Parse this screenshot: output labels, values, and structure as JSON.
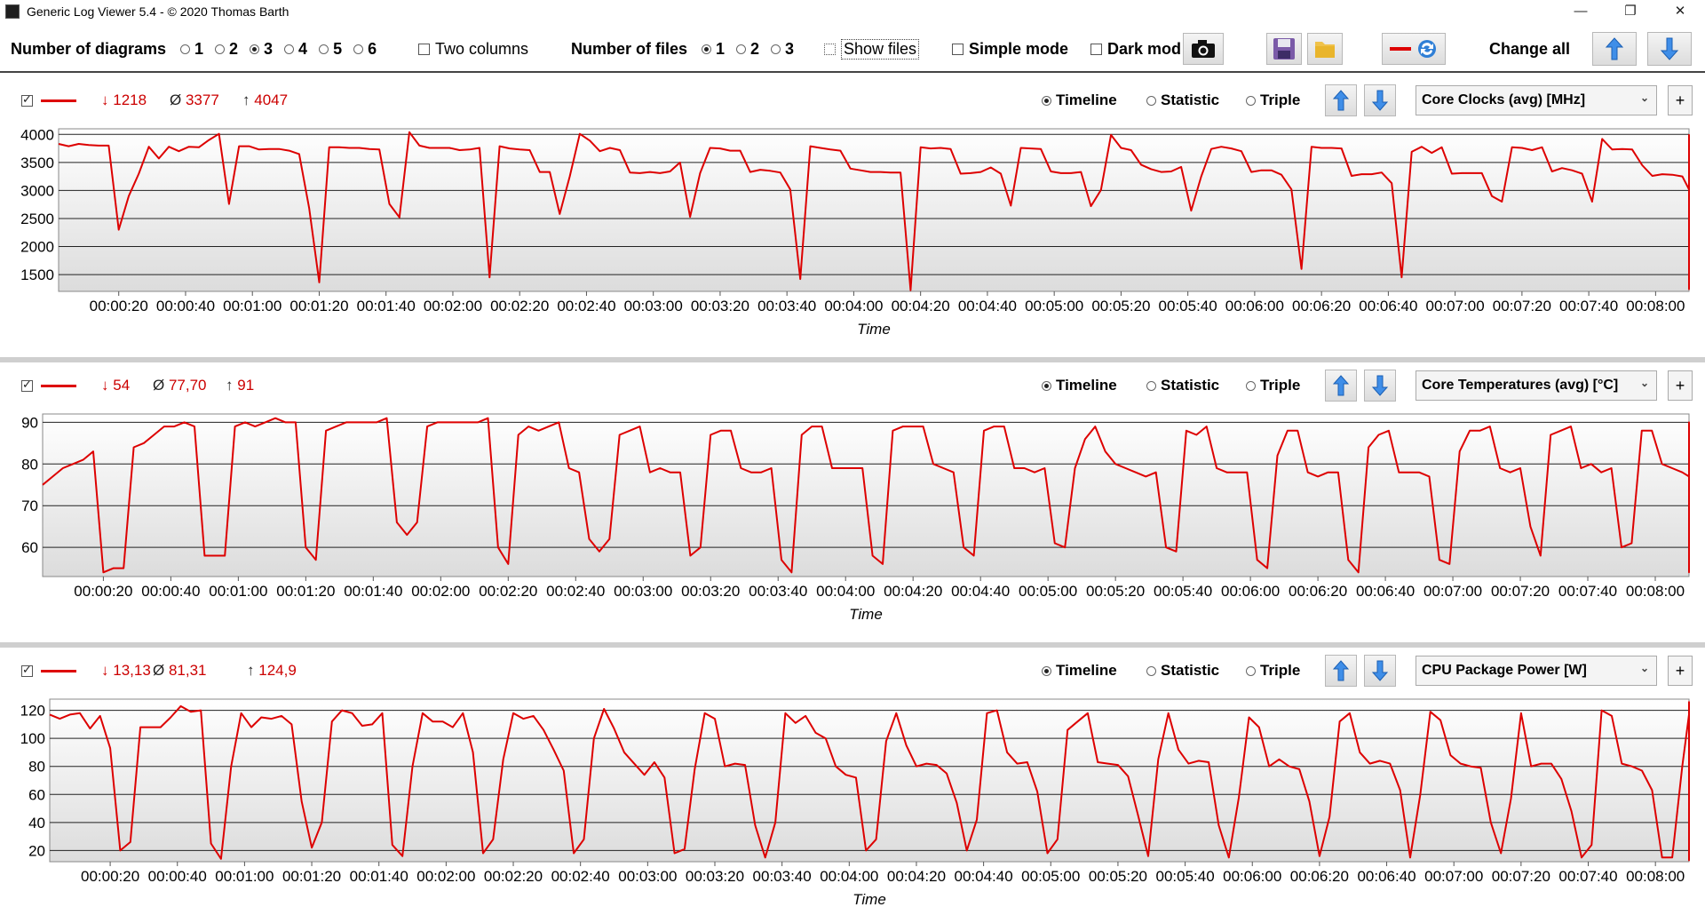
{
  "window": {
    "title": "Generic Log Viewer 5.4 - © 2020 Thomas Barth",
    "controls": {
      "minimize": "—",
      "restore": "❐",
      "close": "✕"
    }
  },
  "toolbar": {
    "num_diagrams_label": "Number of diagrams",
    "diagram_options": [
      "1",
      "2",
      "3",
      "4",
      "5",
      "6"
    ],
    "diagram_selected": "3",
    "two_columns_label": "Two columns",
    "num_files_label": "Number of files",
    "file_options": [
      "1",
      "2",
      "3"
    ],
    "file_selected": "1",
    "show_files_label": "Show files",
    "simple_mode_label": "Simple mode",
    "dark_mode_label": "Dark mod",
    "change_all_label": "Change all",
    "icons": [
      "camera-icon",
      "save-icon",
      "folder-icon",
      "swap-color-icon",
      "arrow-up-icon",
      "arrow-down-icon"
    ]
  },
  "panels": [
    {
      "min": "1218",
      "avg": "3377",
      "max": "4047",
      "min_arrow": "↓",
      "avg_symbol": "Ø",
      "max_arrow": "↑",
      "mode_timeline": "Timeline",
      "mode_statistic": "Statistic",
      "mode_triple": "Triple",
      "sensor": "Core Clocks (avg) [MHz]",
      "plus": "+"
    },
    {
      "min": "54",
      "avg": "77,70",
      "max": "91",
      "min_arrow": "↓",
      "avg_symbol": "Ø",
      "max_arrow": "↑",
      "mode_timeline": "Timeline",
      "mode_statistic": "Statistic",
      "mode_triple": "Triple",
      "sensor": "Core Temperatures (avg) [°C]",
      "plus": "+"
    },
    {
      "min": "13,13",
      "avg": "81,31",
      "max": "124,9",
      "min_arrow": "↓",
      "avg_symbol": "Ø",
      "max_arrow": "↑",
      "mode_timeline": "Timeline",
      "mode_statistic": "Statistic",
      "mode_triple": "Triple",
      "sensor": "CPU Package Power [W]",
      "plus": "+"
    }
  ],
  "colors": {
    "series": "#dd0000",
    "grid": "#222222",
    "plot_bg_top": "#ffffff",
    "plot_bg_bottom": "#dcdcdc"
  },
  "chart_data": [
    {
      "type": "line",
      "xlabel": "Time",
      "x_ticks": [
        "00:00:20",
        "00:00:40",
        "00:01:00",
        "00:01:20",
        "00:01:40",
        "00:02:00",
        "00:02:20",
        "00:02:40",
        "00:03:00",
        "00:03:20",
        "00:03:40",
        "00:04:00",
        "00:04:20",
        "00:04:40",
        "00:05:00",
        "00:05:20",
        "00:05:40",
        "00:06:00",
        "00:06:20",
        "00:06:40",
        "00:07:00",
        "00:07:20",
        "00:07:40",
        "00:08:00"
      ],
      "x_range_s": [
        2,
        490
      ],
      "y_ticks": [
        1500,
        2000,
        2500,
        3000,
        3500,
        4000
      ],
      "ylim": [
        1200,
        4100
      ],
      "sample_interval_s": 3,
      "grid": true,
      "series": [
        {
          "values": [
            3830,
            3790,
            3830,
            3810,
            3800,
            3800,
            2300,
            2900,
            3300,
            3780,
            3570,
            3780,
            3700,
            3780,
            3770,
            3900,
            4010,
            2760,
            3790,
            3790,
            3730,
            3740,
            3740,
            3710,
            3650,
            2680,
            1360,
            3770,
            3770,
            3760,
            3760,
            3740,
            3730,
            2760,
            2520,
            4040,
            3800,
            3760,
            3760,
            3760,
            3720,
            3730,
            3760,
            1450,
            3790,
            3750,
            3730,
            3720,
            3330,
            3330,
            2580,
            3250,
            4010,
            3890,
            3700,
            3760,
            3720,
            3320,
            3310,
            3330,
            3310,
            3340,
            3500,
            2530,
            3310,
            3760,
            3750,
            3710,
            3710,
            3330,
            3370,
            3350,
            3320,
            3020,
            1420,
            3790,
            3760,
            3730,
            3710,
            3390,
            3360,
            3330,
            3330,
            3320,
            3320,
            1220,
            3770,
            3750,
            3760,
            3740,
            3300,
            3310,
            3330,
            3410,
            3300,
            2730,
            3760,
            3750,
            3740,
            3340,
            3310,
            3310,
            3330,
            2720,
            3010,
            3990,
            3760,
            3720,
            3460,
            3380,
            3330,
            3340,
            3420,
            2640,
            3250,
            3740,
            3780,
            3750,
            3700,
            3330,
            3360,
            3360,
            3280,
            3020,
            1600,
            3780,
            3760,
            3760,
            3750,
            3260,
            3290,
            3290,
            3320,
            3130,
            1450,
            3690,
            3780,
            3670,
            3770,
            3300,
            3310,
            3310,
            3310,
            2900,
            2800,
            3770,
            3760,
            3720,
            3770,
            3340,
            3400,
            3360,
            3300,
            2800,
            3920,
            3730,
            3740,
            3730,
            3450,
            3260,
            3290,
            3280,
            3250,
            3020,
            3430,
            3750,
            3310,
            3350,
            3330,
            3310,
            3320,
            3330,
            1240,
            3420,
            3610,
            3760,
            3770,
            3400,
            3340,
            3340,
            3360,
            3310,
            2700,
            1270,
            3790,
            3750,
            3690,
            3760,
            3280,
            3270,
            3330,
            3360,
            3020,
            1250,
            3760,
            3760,
            3710,
            3750,
            3330,
            3300,
            3330,
            3340,
            3090,
            3300,
            3770,
            3740,
            3610,
            3760,
            3330,
            3340,
            3350,
            3360,
            1820,
            3390,
            3310,
            3300,
            3990,
            3290,
            3770,
            3770,
            3760,
            3720,
            3710,
            3680,
            2280,
            3290,
            3720,
            3760,
            3760,
            3760,
            3350,
            3300,
            3310,
            3300,
            3100,
            2250,
            3210,
            3430,
            3750,
            3700,
            3700,
            3450,
            3300,
            3320,
            3250,
            3180,
            3150
          ]
        }
      ]
    },
    {
      "type": "line",
      "xlabel": "Time",
      "x_ticks": [
        "00:00:20",
        "00:00:40",
        "00:01:00",
        "00:01:20",
        "00:01:40",
        "00:02:00",
        "00:02:20",
        "00:02:40",
        "00:03:00",
        "00:03:20",
        "00:03:40",
        "00:04:00",
        "00:04:20",
        "00:04:40",
        "00:05:00",
        "00:05:20",
        "00:05:40",
        "00:06:00",
        "00:06:20",
        "00:06:40",
        "00:07:00",
        "00:07:20",
        "00:07:40",
        "00:08:00"
      ],
      "x_range_s": [
        2,
        490
      ],
      "y_ticks": [
        60,
        70,
        80,
        90
      ],
      "ylim": [
        53,
        92
      ],
      "sample_interval_s": 3,
      "grid": true,
      "series": [
        {
          "values": [
            75,
            77,
            79,
            80,
            81,
            83,
            54,
            55,
            55,
            84,
            85,
            87,
            89,
            89,
            90,
            89,
            58,
            58,
            58,
            89,
            90,
            89,
            90,
            91,
            90,
            90,
            60,
            57,
            88,
            89,
            90,
            90,
            90,
            90,
            91,
            66,
            63,
            66,
            89,
            90,
            90,
            90,
            90,
            90,
            91,
            60,
            56,
            87,
            89,
            88,
            89,
            90,
            79,
            78,
            62,
            59,
            62,
            87,
            88,
            89,
            78,
            79,
            78,
            78,
            58,
            60,
            87,
            88,
            88,
            79,
            78,
            78,
            79,
            57,
            54,
            87,
            89,
            89,
            79,
            79,
            79,
            79,
            58,
            56,
            88,
            89,
            89,
            89,
            80,
            79,
            78,
            60,
            58,
            88,
            89,
            89,
            79,
            79,
            78,
            79,
            61,
            60,
            79,
            86,
            89,
            83,
            80,
            79,
            78,
            77,
            78,
            60,
            59,
            88,
            87,
            89,
            79,
            78,
            78,
            78,
            57,
            55,
            82,
            88,
            88,
            78,
            77,
            78,
            78,
            57,
            54,
            84,
            87,
            88,
            78,
            78,
            78,
            77,
            57,
            56,
            83,
            88,
            88,
            89,
            79,
            78,
            79,
            65,
            58,
            87,
            88,
            89,
            79,
            80,
            78,
            79,
            60,
            61,
            88,
            88,
            80,
            79,
            78,
            77,
            76,
            59,
            56,
            88,
            88,
            89,
            79,
            79,
            79,
            79,
            58,
            54,
            88,
            89,
            89,
            79,
            78,
            78,
            77,
            61,
            54,
            88,
            89,
            88,
            79,
            79,
            78,
            77,
            59,
            57,
            87,
            89,
            88,
            79,
            79,
            78,
            78,
            58,
            58,
            87,
            89,
            89,
            79,
            79,
            78,
            79,
            60,
            58,
            87,
            88,
            89,
            79,
            79,
            79,
            79,
            79,
            58,
            64,
            64,
            89,
            89,
            90,
            80,
            79,
            79,
            58
          ]
        }
      ]
    },
    {
      "type": "line",
      "xlabel": "Time",
      "x_ticks": [
        "00:00:20",
        "00:00:40",
        "00:01:00",
        "00:01:20",
        "00:01:40",
        "00:02:00",
        "00:02:20",
        "00:02:40",
        "00:03:00",
        "00:03:20",
        "00:03:40",
        "00:04:00",
        "00:04:20",
        "00:04:40",
        "00:05:00",
        "00:05:20",
        "00:05:40",
        "00:06:00",
        "00:06:20",
        "00:06:40",
        "00:07:00",
        "00:07:20",
        "00:07:40",
        "00:08:00"
      ],
      "x_range_s": [
        2,
        490
      ],
      "y_ticks": [
        20,
        40,
        60,
        80,
        100,
        120
      ],
      "ylim": [
        12,
        128
      ],
      "sample_interval_s": 3,
      "grid": true,
      "series": [
        {
          "values": [
            117,
            114,
            117,
            118,
            107,
            116,
            93,
            20,
            26,
            108,
            108,
            108,
            115,
            123,
            119,
            120,
            25,
            14,
            80,
            118,
            108,
            115,
            114,
            116,
            110,
            55,
            22,
            40,
            112,
            120,
            118,
            109,
            110,
            118,
            24,
            16,
            80,
            118,
            112,
            112,
            108,
            118,
            90,
            18,
            28,
            85,
            118,
            114,
            116,
            106,
            92,
            77,
            18,
            28,
            100,
            121,
            107,
            90,
            82,
            74,
            83,
            72,
            18,
            21,
            78,
            118,
            114,
            80,
            82,
            81,
            38,
            15,
            40,
            118,
            111,
            116,
            104,
            100,
            80,
            74,
            72,
            20,
            28,
            98,
            118,
            95,
            80,
            82,
            81,
            75,
            54,
            20,
            42,
            118,
            120,
            90,
            82,
            83,
            62,
            18,
            28,
            106,
            112,
            118,
            83,
            82,
            81,
            73,
            45,
            16,
            85,
            118,
            92,
            82,
            84,
            83,
            38,
            15,
            58,
            115,
            108,
            80,
            85,
            80,
            78,
            55,
            16,
            44,
            112,
            118,
            90,
            82,
            84,
            82,
            63,
            15,
            60,
            119,
            113,
            88,
            82,
            80,
            79,
            40,
            18,
            57,
            118,
            80,
            82,
            82,
            71,
            48,
            15,
            24,
            120,
            116,
            82,
            80,
            77,
            63,
            15,
            15,
            80,
            117,
            82,
            81,
            72,
            50,
            15,
            22,
            75,
            113,
            88,
            82,
            85,
            78,
            55,
            16,
            40,
            119,
            108,
            90,
            76,
            72,
            62,
            15,
            24,
            85,
            118,
            80,
            82,
            70,
            50,
            15,
            36,
            117,
            100,
            88,
            82,
            80,
            73,
            15,
            18,
            62,
            126,
            88,
            82,
            84,
            82,
            60,
            15,
            30,
            111,
            89,
            78,
            82,
            79,
            60,
            14,
            52,
            113,
            90,
            83,
            82,
            77,
            61,
            15,
            38,
            113,
            114,
            108,
            84,
            79,
            76,
            23,
            13,
            64,
            112,
            113,
            110,
            120,
            59,
            45,
            22,
            68,
            110,
            112,
            84,
            80,
            81,
            78,
            55
          ]
        }
      ]
    }
  ]
}
